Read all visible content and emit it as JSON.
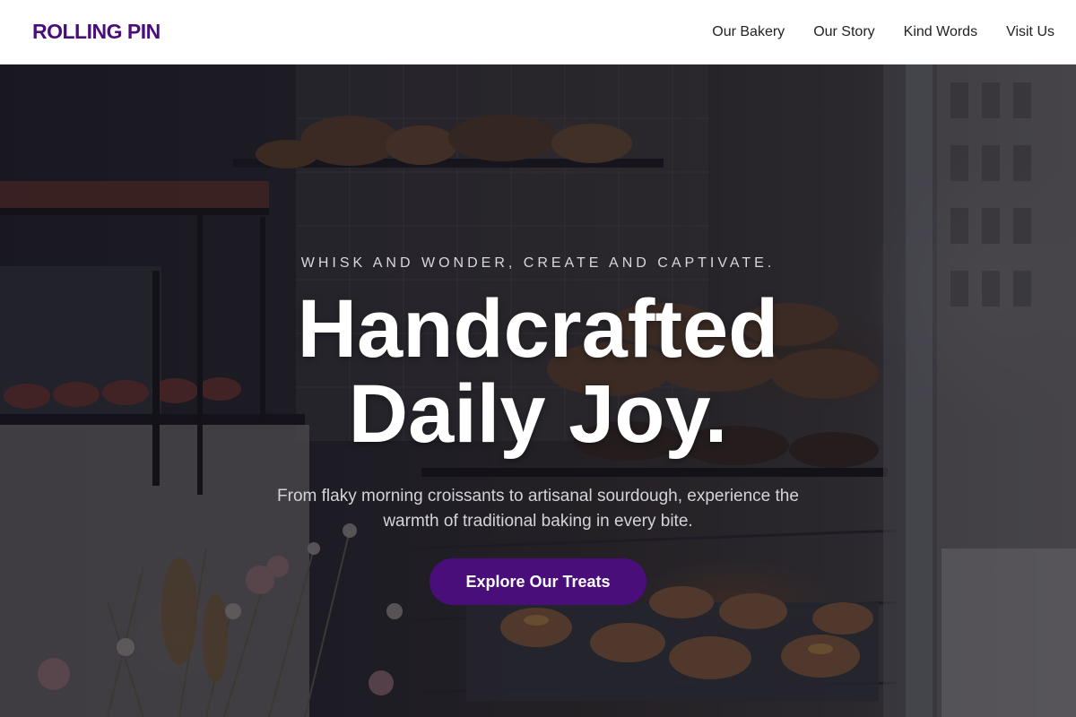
{
  "brand": {
    "name": "ROLLING PIN",
    "color": "#4a0e7a"
  },
  "nav": {
    "items": [
      {
        "label": "Our Bakery"
      },
      {
        "label": "Our Story"
      },
      {
        "label": "Kind Words"
      },
      {
        "label": "Visit Us"
      }
    ]
  },
  "hero": {
    "background": "bakery display window with bread shelves, pastries and flowers",
    "tagline": "Whisk and Wonder, Create and Captivate.",
    "headline_line1": "Handcrafted",
    "headline_line2": "Daily Joy.",
    "subtitle": "From flaky morning croissants to artisanal sourdough, experience the warmth of traditional baking in every bite.",
    "cta_label": "Explore Our Treats",
    "cta_color": "#4a0e7a"
  }
}
